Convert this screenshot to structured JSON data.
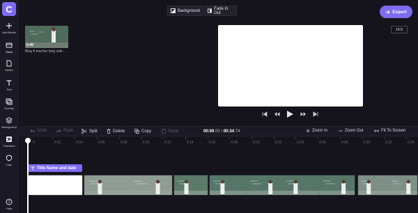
{
  "app": {
    "logo_letter": "C"
  },
  "sidebar": {
    "items": [
      {
        "label": "Add Media",
        "icon": "plus-icon"
      },
      {
        "label": "Stock",
        "icon": "stock-icon"
      },
      {
        "label": "Media",
        "icon": "media-icon"
      },
      {
        "label": "Text",
        "icon": "text-icon"
      },
      {
        "label": "Overlay",
        "icon": "overlay-icon"
      },
      {
        "label": "Background",
        "icon": "background-icon"
      },
      {
        "label": "Transition",
        "icon": "transition-icon"
      },
      {
        "label": "Logo",
        "icon": "logo-icon"
      },
      {
        "label": "Help",
        "icon": "help-icon"
      }
    ]
  },
  "topbar": {
    "background_label": "Background",
    "fade_label": "Fade In Out",
    "export_label": "Export"
  },
  "media": {
    "duration": "0:45",
    "name": "Blog ft teacher long vide..."
  },
  "preview": {
    "aspect_ratio": "16:9"
  },
  "toolbar": {
    "undo": "Undo",
    "redo": "Redo",
    "split": "Split",
    "delete": "Delete",
    "copy": "Copy",
    "paste": "Paste",
    "time_current": "00:00",
    "time_current_frac": ".00",
    "time_sep": " / ",
    "time_total": "00:34",
    "time_total_frac": ".74",
    "zoom_in": "Zoom In",
    "zoom_out": "Zoom Out",
    "fit": "Fit To Screen"
  },
  "ruler": {
    "ticks": [
      ":0",
      "0:02",
      "0:04",
      "0:06",
      "0:08",
      "0:10",
      "0:12",
      "0:14",
      "0:16",
      "0:18",
      "0:20",
      "0:22",
      "0:24",
      "0:26",
      "0:28",
      "0:30",
      "0:32",
      "0:34"
    ]
  },
  "timeline": {
    "title_clip_label": "Title Name and date"
  },
  "colors": {
    "accent": "#7c6cf0",
    "background": "#15141c",
    "panel": "#1b1a24"
  }
}
